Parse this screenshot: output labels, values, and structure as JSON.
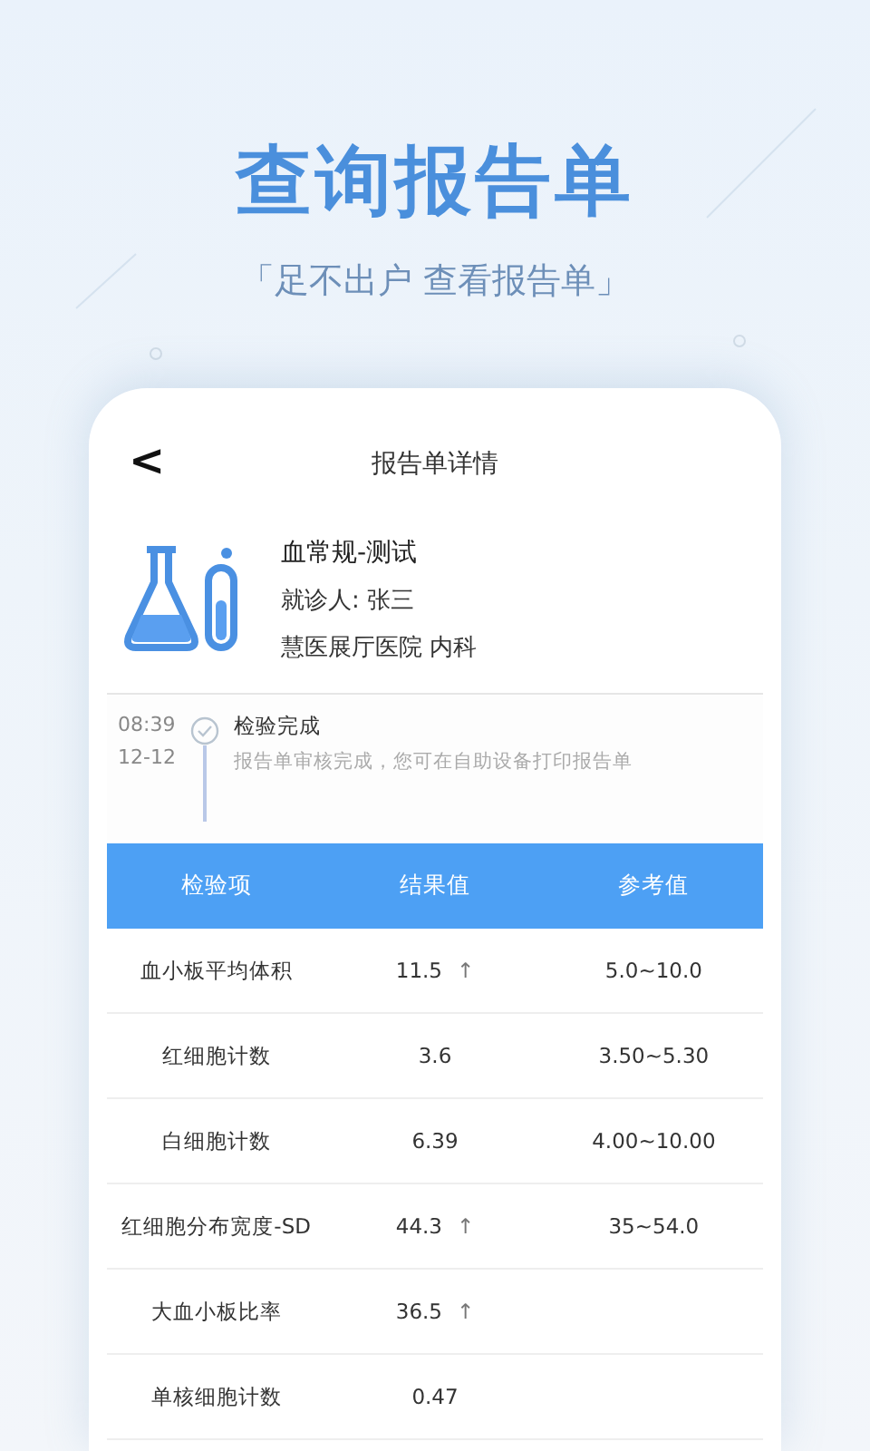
{
  "headline": "查询报告单",
  "tagline": "「足不出户 查看报告单」",
  "screen": {
    "title": "报告单详情",
    "back": "<",
    "report": {
      "name": "血常规-测试",
      "patient": "就诊人: 张三",
      "hospital": "慧医展厅医院 内科"
    },
    "timeline": [
      {
        "time": "08:39",
        "date": "12-12",
        "status": "检验完成",
        "detail": "报告单审核完成，您可在自助设备打印报告单",
        "done": true
      }
    ],
    "table": {
      "columns": [
        "检验项",
        "结果值",
        "参考值"
      ],
      "rows": [
        {
          "item": "血小板平均体积",
          "result": "11.5",
          "arrow": "↑",
          "reference": "5.0~10.0"
        },
        {
          "item": "红细胞计数",
          "result": "3.6",
          "reference": "3.50~5.30"
        },
        {
          "item": "白细胞计数",
          "result": "6.39",
          "reference": "4.00~10.00"
        },
        {
          "item": "红细胞分布宽度-SD",
          "result": "44.3",
          "arrow": "↑",
          "reference": "35~54.0"
        },
        {
          "item": "大血小板比率",
          "result": "36.5",
          "arrow": "↑"
        },
        {
          "item": "单核细胞计数",
          "result": "0.47"
        }
      ]
    }
  }
}
